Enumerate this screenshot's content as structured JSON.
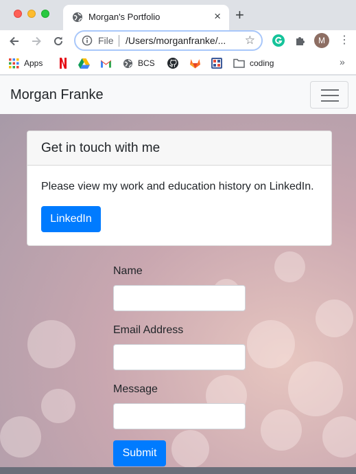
{
  "browser": {
    "tab_title": "Morgan's Portfolio",
    "tab_close": "×",
    "new_tab": "+",
    "address_prefix": "File",
    "address_url": "/Users/morganfranke/...",
    "profile_initial": "M",
    "menu": "⋮",
    "bookmarks": [
      {
        "label": "Apps",
        "icon": "apps-grid-icon"
      },
      {
        "label": "",
        "icon": "netflix-icon"
      },
      {
        "label": "",
        "icon": "google-drive-icon"
      },
      {
        "label": "",
        "icon": "gmail-icon"
      },
      {
        "label": "BCS",
        "icon": "globe-icon"
      },
      {
        "label": "",
        "icon": "github-icon"
      },
      {
        "label": "",
        "icon": "gitlab-icon"
      },
      {
        "label": "",
        "icon": "bookmark-app-icon"
      },
      {
        "label": "coding",
        "icon": "folder-icon"
      }
    ],
    "bookmarks_more": "»"
  },
  "page": {
    "navbar": {
      "brand": "Morgan Franke"
    },
    "card": {
      "title": "Get in touch with me",
      "text": "Please view my work and education history on LinkedIn.",
      "button_label": "LinkedIn"
    },
    "form": {
      "name_label": "Name",
      "name_value": "",
      "email_label": "Email Address",
      "email_value": "",
      "message_label": "Message",
      "message_value": "",
      "submit_label": "Submit"
    }
  },
  "colors": {
    "primary": "#007bff",
    "navbar_bg": "#f8f9fa",
    "chrome_bg": "#dee1e6"
  }
}
